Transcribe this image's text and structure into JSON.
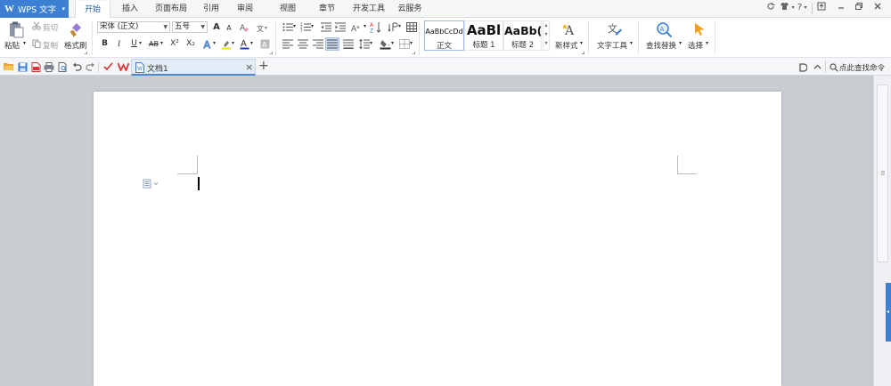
{
  "app_button": {
    "logo": "W",
    "label": "WPS 文字",
    "dropdown": "▾"
  },
  "menu_tabs": [
    "开始",
    "插入",
    "页面布局",
    "引用",
    "审阅",
    "视图",
    "章节",
    "开发工具",
    "云服务"
  ],
  "window_controls": {
    "help": "?",
    "help_dd": "▾"
  },
  "clipboard": {
    "paste": "粘贴",
    "paste_dd": "▾",
    "cut": "剪切",
    "copy": "复制",
    "format_painter": "格式刷"
  },
  "font": {
    "name": "宋体 (正文)",
    "size": "五号"
  },
  "font_buttons": {
    "grow": "A",
    "shrink": "A",
    "bold": "B",
    "italic": "I",
    "underline": "U",
    "strike": "AB",
    "superscript": "X²",
    "subscript": "X₂",
    "font_color": "A"
  },
  "styles": [
    {
      "preview": "AaBbCcDd",
      "name": "正文"
    },
    {
      "preview": "AaBl",
      "name": "标题 1"
    },
    {
      "preview": "AaBb(",
      "name": "标题 2"
    }
  ],
  "new_style": "新样式",
  "text_tools": "文字工具",
  "find_replace": "查找替换",
  "select": "选择",
  "quick_toolbar": {
    "doc_tab": "文档1",
    "close": "×",
    "add": "+",
    "search_placeholder": "点此查找命令"
  },
  "colors": {
    "accent": "#3d7fd3",
    "highlight": "#f2e600",
    "font_color": "#1f3fbf"
  }
}
